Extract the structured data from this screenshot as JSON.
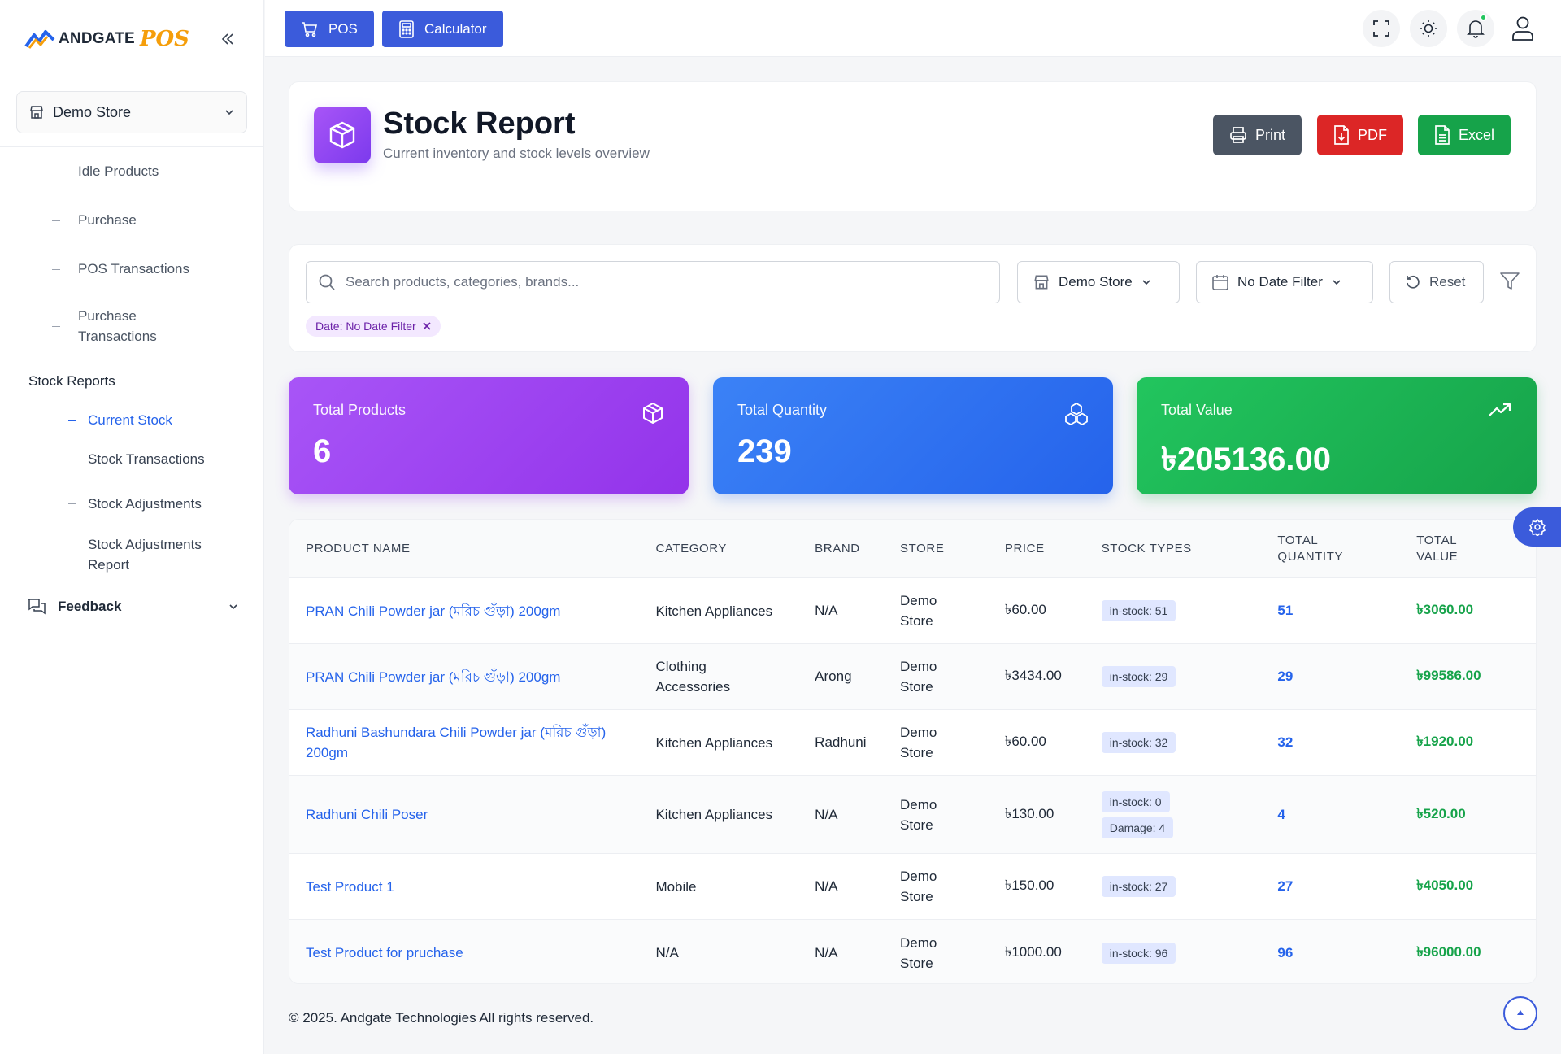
{
  "brand": {
    "name": "ANDGATE",
    "suffix": "POS"
  },
  "sidebar": {
    "store": "Demo Store",
    "items": [
      {
        "label": "Idle Products"
      },
      {
        "label": "Purchase"
      },
      {
        "label": "POS Transactions"
      },
      {
        "label": "Purchase\nTransactions"
      }
    ],
    "section": "Stock Reports",
    "sub_items": [
      {
        "label": "Current Stock"
      },
      {
        "label": "Stock Transactions"
      },
      {
        "label": "Stock Adjustments"
      },
      {
        "label": "Stock Adjustments\nReport"
      }
    ],
    "feedback": "Feedback"
  },
  "topbar": {
    "pos_label": "POS",
    "calculator_label": "Calculator"
  },
  "header": {
    "title": "Stock Report",
    "subtitle": "Current inventory and stock levels overview",
    "print_label": "Print",
    "pdf_label": "PDF",
    "excel_label": "Excel"
  },
  "filters": {
    "search_placeholder": "Search products, categories, brands...",
    "store": "Demo Store",
    "date": "No Date Filter",
    "reset": "Reset",
    "chip": "Date: No Date Filter"
  },
  "stats": {
    "products": {
      "label": "Total Products",
      "value": "6"
    },
    "quantity": {
      "label": "Total Quantity",
      "value": "239"
    },
    "value": {
      "label": "Total Value",
      "value": "৳205136.00"
    }
  },
  "table": {
    "columns": [
      "PRODUCT NAME",
      "CATEGORY",
      "BRAND",
      "STORE",
      "PRICE",
      "STOCK TYPES",
      "TOTAL\nQUANTITY",
      "TOTAL\nVALUE"
    ],
    "rows": [
      {
        "name": "PRAN Chili Powder jar (মরিচ গুঁড়া) 200gm",
        "category": "Kitchen Appliances",
        "brand": "N/A",
        "store": "Demo\nStore",
        "price": "৳60.00",
        "badges": [
          "in-stock: 51"
        ],
        "qty": "51",
        "value": "৳3060.00"
      },
      {
        "name": "PRAN Chili Powder jar (মরিচ গুঁড়া) 200gm",
        "category": "Clothing\nAccessories",
        "brand": "Arong",
        "store": "Demo\nStore",
        "price": "৳3434.00",
        "badges": [
          "in-stock: 29"
        ],
        "qty": "29",
        "value": "৳99586.00"
      },
      {
        "name": "Radhuni Bashundara Chili Powder jar (মরিচ গুঁড়া)\n200gm",
        "category": "Kitchen Appliances",
        "brand": "Radhuni",
        "store": "Demo\nStore",
        "price": "৳60.00",
        "badges": [
          "in-stock: 32"
        ],
        "qty": "32",
        "value": "৳1920.00"
      },
      {
        "name": "Radhuni Chili Poser",
        "category": "Kitchen Appliances",
        "brand": "N/A",
        "store": "Demo\nStore",
        "price": "৳130.00",
        "badges": [
          "in-stock: 0",
          "Damage: 4"
        ],
        "qty": "4",
        "value": "৳520.00"
      },
      {
        "name": "Test Product 1",
        "category": "Mobile",
        "brand": "N/A",
        "store": "Demo\nStore",
        "price": "৳150.00",
        "badges": [
          "in-stock: 27"
        ],
        "qty": "27",
        "value": "৳4050.00"
      },
      {
        "name": "Test Product for pruchase",
        "category": "N/A",
        "brand": "N/A",
        "store": "Demo\nStore",
        "price": "৳1000.00",
        "badges": [
          "in-stock: 96"
        ],
        "qty": "96",
        "value": "৳96000.00"
      }
    ]
  },
  "footer": "© 2025. Andgate Technologies All rights reserved.",
  "colors": {
    "primary": "#3b5bdb",
    "purple": "#9333ea",
    "blue": "#2563eb",
    "green": "#16a34a",
    "red": "#dc2626",
    "gray": "#4b5563"
  },
  "icons": [
    "chevrons-left-icon",
    "store-icon",
    "chevron-down-icon",
    "cart-icon",
    "calculator-icon",
    "fullscreen-icon",
    "sun-icon",
    "bell-icon",
    "user-icon",
    "box-icon",
    "printer-icon",
    "pdf-file-icon",
    "excel-file-icon",
    "search-icon",
    "calendar-icon",
    "reset-icon",
    "funnel-icon",
    "close-icon",
    "boxes-icon",
    "trend-up-icon",
    "settings-icon",
    "arrow-up-icon",
    "feedback-icon"
  ]
}
